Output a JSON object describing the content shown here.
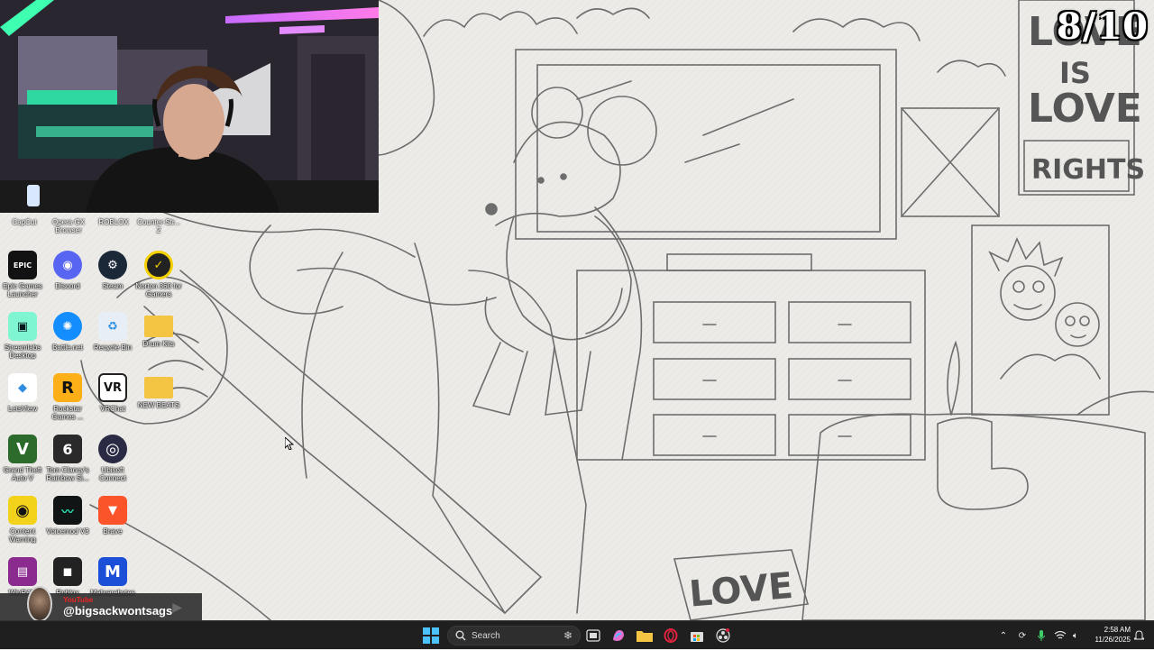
{
  "overlay": {
    "score": "8/10"
  },
  "wallpaper": {
    "poster_text": [
      "LOVE",
      "IS",
      "LOVE",
      "RIGHTS"
    ],
    "rug_text": "LOVE"
  },
  "desktop": {
    "partial_labels": [
      "CapCut",
      "Opera GX Browser",
      "ROBLOX",
      "Counter-Str... 2"
    ],
    "icons": [
      {
        "label": "Epic Games Launcher",
        "glyph": "EPIC",
        "icon": "epic-games-icon",
        "color": "#121212"
      },
      {
        "label": "Discord",
        "glyph": "◉",
        "icon": "discord-icon",
        "color": "#5865f2"
      },
      {
        "label": "Steam",
        "glyph": "⚙",
        "icon": "steam-icon",
        "color": "#1b2838"
      },
      {
        "label": "Norton 360 for Gamers",
        "glyph": "✓",
        "icon": "norton-icon",
        "color": "#222222"
      },
      {
        "label": "Streamlabs Desktop",
        "glyph": "▣",
        "icon": "streamlabs-icon",
        "color": "#80f5d2"
      },
      {
        "label": "Battle.net",
        "glyph": "✺",
        "icon": "battlenet-icon",
        "color": "#148eff"
      },
      {
        "label": "Recycle Bin",
        "glyph": "♻",
        "icon": "recycle-bin-icon",
        "color": "#e8eef6"
      },
      {
        "label": "Drum Kits",
        "glyph": "",
        "icon": "folder-icon",
        "color": "#f4c542"
      },
      {
        "label": "LetsView",
        "glyph": "◆",
        "icon": "letsview-icon",
        "color": "#ffffff"
      },
      {
        "label": "Rockstar Games ...",
        "glyph": "R",
        "icon": "rockstar-icon",
        "color": "#fcaf17"
      },
      {
        "label": "VRChat",
        "glyph": "VR",
        "icon": "vrchat-icon",
        "color": "#ffffff"
      },
      {
        "label": "NEW BEATS",
        "glyph": "",
        "icon": "folder-icon",
        "color": "#f4c542"
      },
      {
        "label": "Grand Theft Auto V",
        "glyph": "V",
        "icon": "gta-icon",
        "color": "#2d6b2d"
      },
      {
        "label": "Tom Clancy's Rainbow Si...",
        "glyph": "6",
        "icon": "rainbow-six-icon",
        "color": "#2a2a2a"
      },
      {
        "label": "Ubisoft Connect",
        "glyph": "◎",
        "icon": "ubisoft-icon",
        "color": "#2a2a44"
      },
      {
        "label": "Content Warning",
        "glyph": "◉",
        "icon": "content-warning-icon",
        "color": "#f2d21b"
      },
      {
        "label": "Voicemod V3",
        "glyph": "〰",
        "icon": "voicemod-icon",
        "color": "#101414"
      },
      {
        "label": "Brave",
        "glyph": "▼",
        "icon": "brave-icon",
        "color": "#fb542b"
      },
      {
        "label": "WinRAR",
        "glyph": "▤",
        "icon": "winrar-icon",
        "color": "#8b2a8f"
      },
      {
        "label": "Roblox",
        "glyph": "◼",
        "icon": "roblox-icon",
        "color": "#222222"
      },
      {
        "label": "Malwarebytes",
        "glyph": "M",
        "icon": "malwarebytes-icon",
        "color": "#1b4fd8"
      }
    ]
  },
  "social": {
    "platform": "YouTube",
    "handle": "@bigsackwontsags"
  },
  "taskbar": {
    "search_placeholder": "Search",
    "time": "2:58 AM",
    "date": "11/26/2025"
  }
}
